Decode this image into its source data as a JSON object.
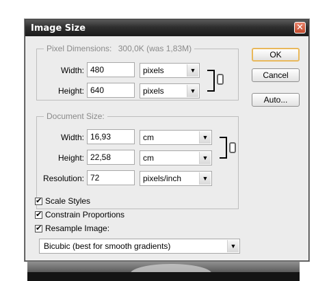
{
  "window": {
    "title": "Image Size"
  },
  "pixel_dimensions": {
    "label": "Pixel Dimensions:",
    "info": "300,0K (was 1,83M)",
    "width_label": "Width:",
    "width_value": "480",
    "width_unit": "pixels",
    "height_label": "Height:",
    "height_value": "640",
    "height_unit": "pixels"
  },
  "document_size": {
    "label": "Document Size:",
    "width_label": "Width:",
    "width_value": "16,93",
    "width_unit": "cm",
    "height_label": "Height:",
    "height_value": "22,58",
    "height_unit": "cm",
    "resolution_label": "Resolution:",
    "resolution_value": "72",
    "resolution_unit": "pixels/inch"
  },
  "buttons": {
    "ok": "OK",
    "cancel": "Cancel",
    "auto": "Auto..."
  },
  "options": {
    "scale_styles": "Scale Styles",
    "constrain_proportions": "Constrain Proportions",
    "resample_image": "Resample Image:",
    "resample_method": "Bicubic (best for smooth gradients)",
    "checked_mark": "✔"
  },
  "icons": {
    "dropdown": "▼",
    "close": "✕"
  }
}
